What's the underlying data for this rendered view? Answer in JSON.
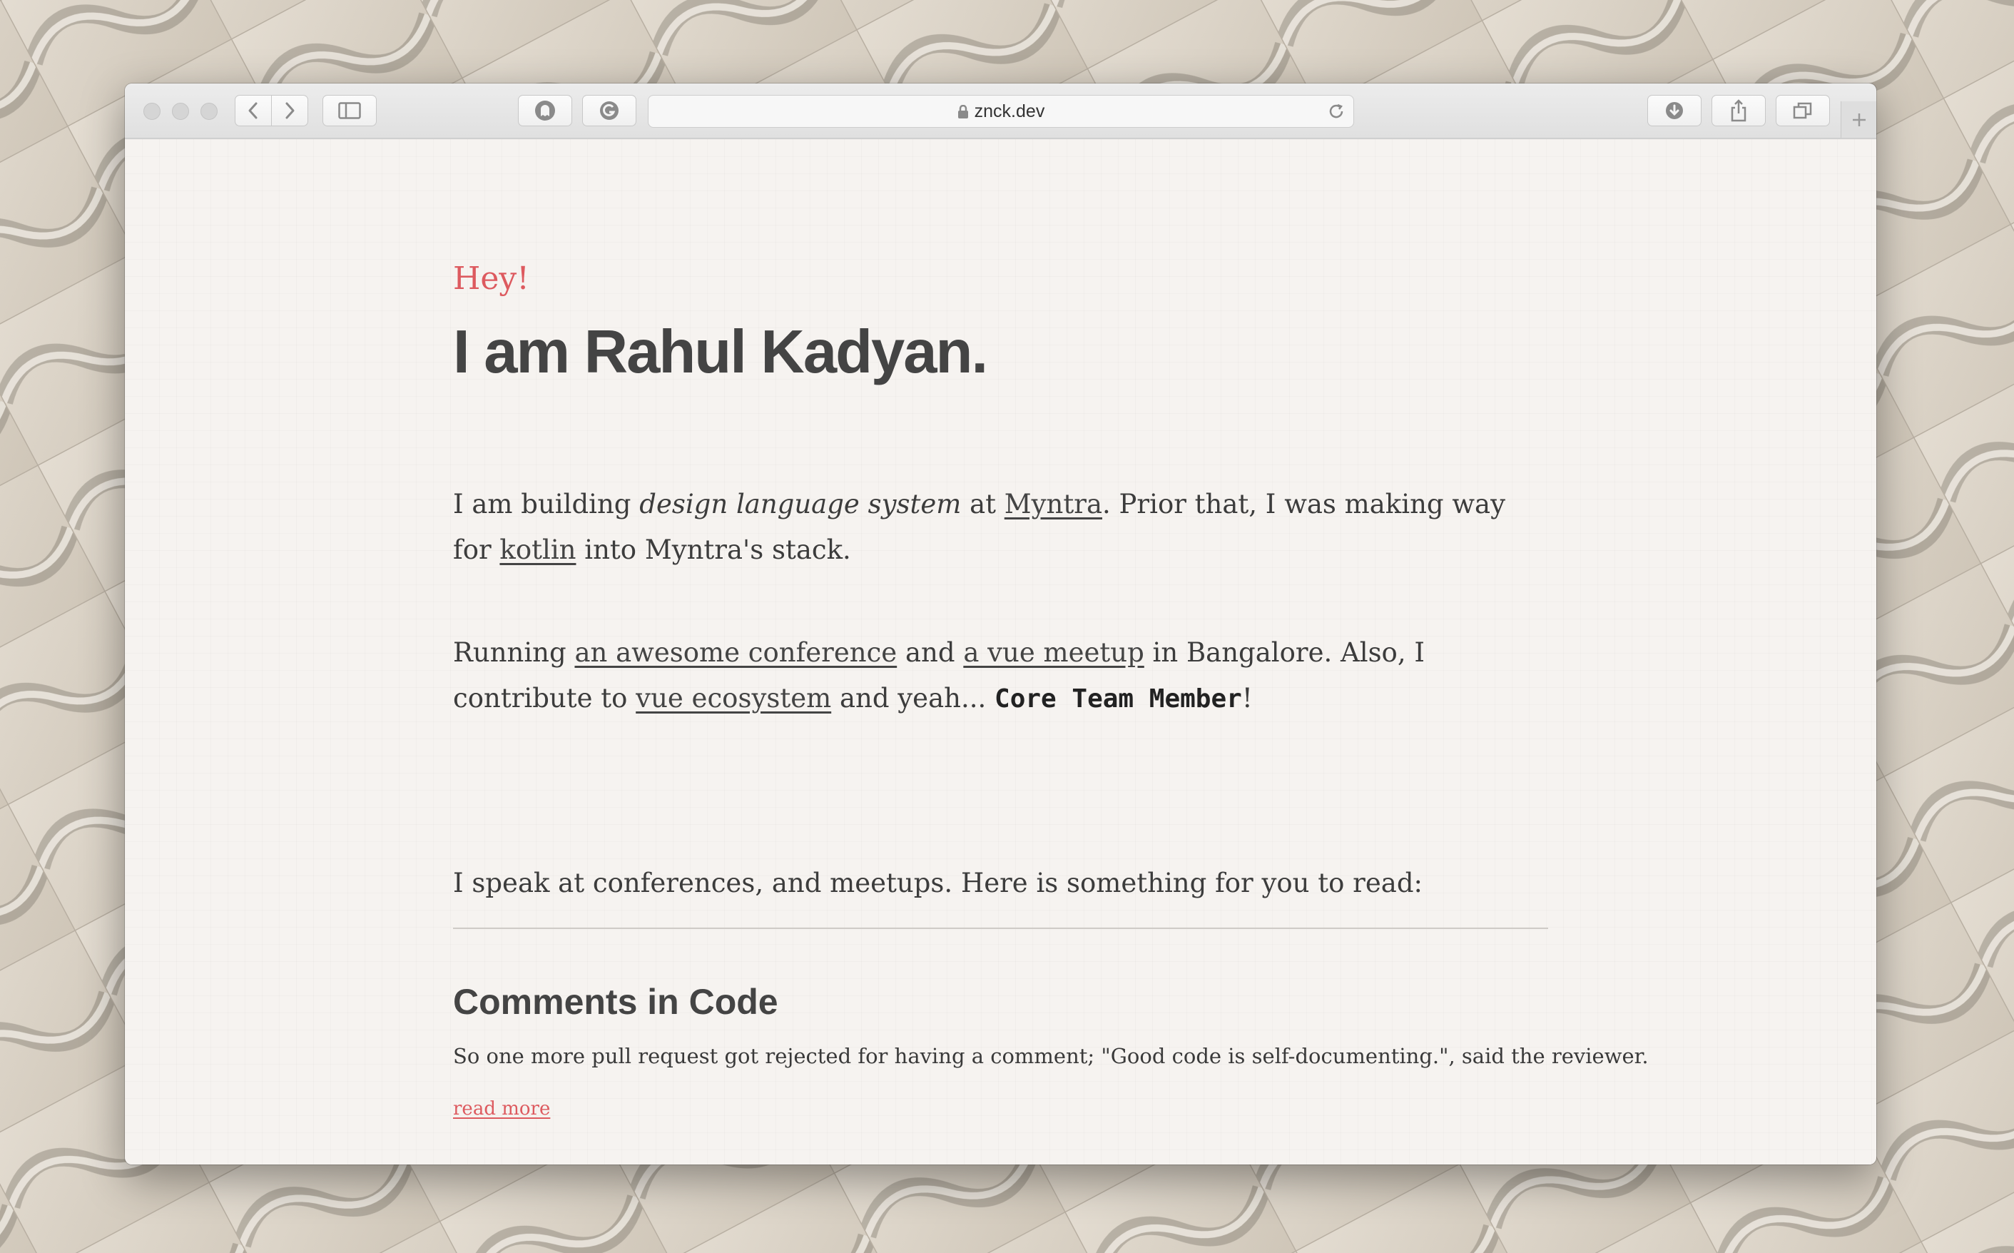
{
  "browser": {
    "url": "znck.dev"
  },
  "page": {
    "greeting": "Hey!",
    "heading": "I am Rahul Kadyan.",
    "intro": {
      "t1": "I am building ",
      "em": "design language system",
      "t2": " at ",
      "link_myntra": "Myntra",
      "t3": ". Prior that, I was making way for ",
      "link_kotlin": "kotlin",
      "t4": " into Myntra's stack."
    },
    "community": {
      "t1": "Running ",
      "link_conference": "an awesome conference",
      "t2": " and ",
      "link_meetup": "a vue meetup",
      "t3": " in Bangalore. Also, I contribute to ",
      "link_ecosystem": "vue ecosystem",
      "t4": " and yeah... ",
      "strong": "Core Team Member",
      "t5": "!"
    },
    "speaking": "I speak at conferences, and meetups. Here is something for you to read:",
    "post": {
      "title": "Comments in Code",
      "excerpt": "So one more pull request got rejected for having a comment; \"Good code is self-documenting.\", said the reviewer.",
      "read_more": "read more"
    }
  },
  "colors": {
    "accent": "#dd5a5f",
    "text": "#3c3c3c",
    "heading": "#444444",
    "page_bg": "#f6f3f0"
  },
  "icons": [
    "back-icon",
    "forward-icon",
    "sidebar-icon",
    "ghostery-icon",
    "grammarly-icon",
    "lock-icon",
    "reload-icon",
    "download-icon",
    "share-icon",
    "tabs-icon",
    "plus-icon"
  ]
}
